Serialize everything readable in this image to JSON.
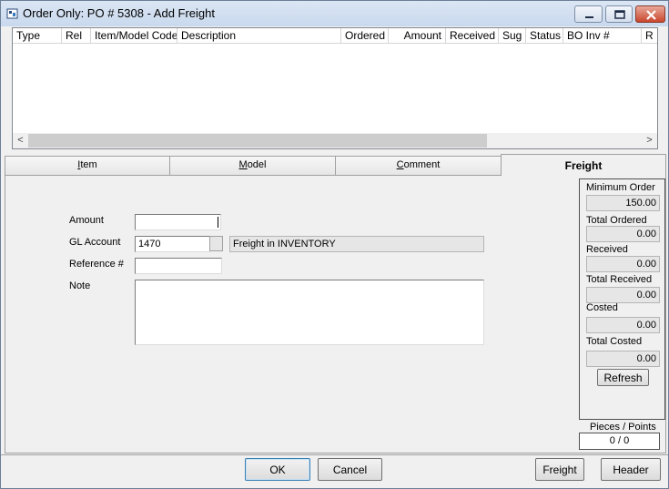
{
  "window": {
    "title": "Order Only: PO # 5308  - Add Freight"
  },
  "grid": {
    "columns": [
      "Type",
      "Rel",
      "Item/Model Code",
      "Description",
      "Ordered",
      "Amount",
      "Received",
      "Sug",
      "Status",
      "BO Inv #",
      "R"
    ],
    "left_arrow": "<",
    "right_arrow": ">"
  },
  "tabs": [
    {
      "pre": "",
      "key": "I",
      "post": "tem",
      "active": false
    },
    {
      "pre": "",
      "key": "M",
      "post": "odel",
      "active": false
    },
    {
      "pre": "",
      "key": "C",
      "post": "omment",
      "active": false
    },
    {
      "pre": "",
      "key": "",
      "post": "Freight",
      "active": true
    }
  ],
  "form": {
    "amount_label": "Amount",
    "amount_value": "",
    "gl_account_label": "GL Account",
    "gl_account_value": "1470",
    "gl_account_desc": "Freight in INVENTORY",
    "reference_label": "Reference #",
    "reference_value": "",
    "note_label": "Note",
    "note_value": ""
  },
  "summary": {
    "minimum_order_label": "Minimum Order",
    "minimum_order_value": "150.00",
    "total_ordered_label": "Total Ordered",
    "total_ordered_value": "0.00",
    "received_label": "Received",
    "received_value": "0.00",
    "total_received_label": "Total Received",
    "total_received_value": "0.00",
    "costed_label": "Costed",
    "costed_value": "0.00",
    "total_costed_label": "Total Costed",
    "total_costed_value": "0.00",
    "refresh_label": "Refresh",
    "pieces_label": "Pieces / Points",
    "pieces_value": "0 / 0"
  },
  "buttons": {
    "ok": "OK",
    "cancel": "Cancel",
    "freight": "Freight",
    "header": "Header"
  },
  "icons": {
    "app": "app-icon",
    "minimize": "minimize-icon",
    "maximize": "maximize-icon",
    "close": "close-icon"
  }
}
